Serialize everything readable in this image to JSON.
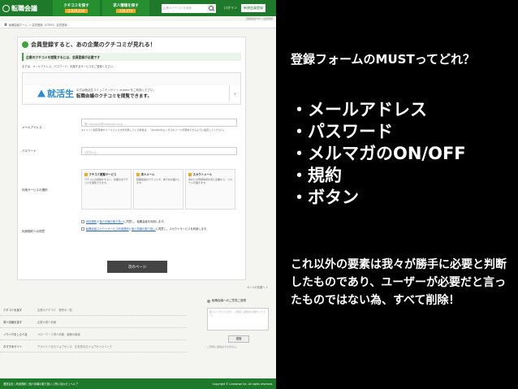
{
  "header": {
    "logo_text": "転職会議",
    "nav": [
      {
        "label": "クチコミを探す",
        "count": "2,928,034"
      },
      {
        "label": "求人情報を探す",
        "count": "339,476"
      }
    ],
    "search_placeholder": "企業のクチコミを検索",
    "login_label": "ログイン",
    "register_label": "新規会員登録",
    "sub_right": "転職会議TOP | 会員登録"
  },
  "breadcrumb": "転職会議ホーム ＞ 会員登録（STEP1）会員登録",
  "form": {
    "title_pre": "会員登録すると、",
    "title_hl": "あの企業のクチコミが見れる！",
    "notice": "企業のクチコミを閲覧するには、会員登録が必要です",
    "intro": "まずは、メールアドレス、パスワード、利用するサービスをご登録ください。",
    "banner": {
      "brand": "就活生",
      "line1": "の方は就活生コミュニティサイト onemo をご利用ください。",
      "line2": "転職会議のクチコミを閲覧できます。",
      "arrow": "›"
    },
    "email_label": "メールアドレス",
    "email_placeholder": "例) example@livesense.co.jp",
    "email_help": "※ドメイン指定受信やメールフィルタを利用している場合は、「@jobtalk.jp」からのメールが受信できるように設定してください。",
    "password_label": "パスワード",
    "password_placeholder": "4文字以上",
    "service_label": "利用サービスの選択",
    "services": [
      {
        "title": "クチコミ閲覧サービス",
        "desc": "クチコミの投稿をすると、企業の全クチコミを閲覧できます。"
      },
      {
        "title": "求人メール",
        "desc": "転職会議のクチコミや、求人をお届けします。"
      },
      {
        "title": "スカウトメール",
        "desc": "あなたの登録情報を見た企業から、スカウトが届きます。"
      }
    ],
    "agree_label": "利用規約への同意",
    "agree_lines": [
      {
        "a": "利用規約",
        "b": "と",
        "c": "個人情報の取り扱い",
        "d": "に同意し、転職会議を利用します。"
      },
      {
        "a": "転職会議スカウトサービス利用規約",
        "b": "と",
        "c": "個人情報の取り扱い",
        "d": "に同意し、スカウトサービスを利用します。"
      }
    ],
    "submit_label": "次のページ"
  },
  "pagetop": "ページの先頭へ ↑",
  "footer_links": [
    {
      "label": "クチコミを探す",
      "value": "企業のクチコミ　業界の一覧"
    },
    {
      "label": "求人情報を探す",
      "value": "企業の求人情報"
    },
    {
      "label": "ノウハウをしらべる",
      "value": "ハローワーク求人情報　転職の面接"
    },
    {
      "label": "おすすめサイト",
      "value": "アルバイトならジョブセンス　正社員ならジョブセンスリンク"
    }
  ],
  "feedback": {
    "title": "転職会議へのご意見ご感想",
    "placeholder": "使いにくかった点や、ご意見ご感想をお寄せください。",
    "send_label": "送信",
    "note": "ご意見に返信はできません。"
  },
  "bottom": {
    "links": "運営会社 | 利用規約 | 個人情報の取り扱い | 問い合わせ | ヘルプ",
    "copyright": "Copyright © Livesense Inc. All rights reserved."
  },
  "commentary": {
    "title": "登録フォームのMUSTってどれ？",
    "bullets": [
      "・メールアドレス",
      "・パスワード",
      "・メルマガのON/OFF",
      "・規約",
      "・ボタン"
    ],
    "note": "これ以外の要素は我々が勝手に必要と判断したものであり、ユーザーが必要だと言ったものではない為、すべて削除！"
  },
  "colors": {
    "brand_green": "#1e7a2a",
    "accent_orange": "#f5a623",
    "highlight_red": "#c0392b"
  }
}
